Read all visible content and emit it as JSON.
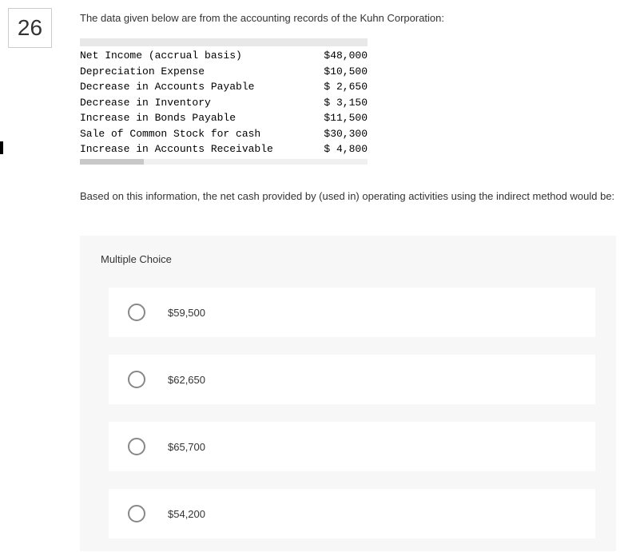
{
  "questionNumber": "26",
  "intro": "The data given below are from the accounting records of the Kuhn Corporation:",
  "rows": [
    {
      "label": "Net Income (accrual basis)",
      "value": "$48,000"
    },
    {
      "label": "Depreciation Expense",
      "value": "$10,500"
    },
    {
      "label": "Decrease in Accounts Payable",
      "value": "$ 2,650"
    },
    {
      "label": "Decrease in Inventory",
      "value": "$ 3,150"
    },
    {
      "label": "Increase in Bonds Payable",
      "value": "$11,500"
    },
    {
      "label": "Sale of Common Stock for cash",
      "value": "$30,300"
    },
    {
      "label": "Increase in Accounts Receivable",
      "value": "$ 4,800"
    }
  ],
  "questionText": "Based on this information, the net cash provided by (used in) operating activities using the indirect method would be:",
  "mcHeading": "Multiple Choice",
  "options": [
    {
      "label": "$59,500"
    },
    {
      "label": "$62,650"
    },
    {
      "label": "$65,700"
    },
    {
      "label": "$54,200"
    }
  ]
}
